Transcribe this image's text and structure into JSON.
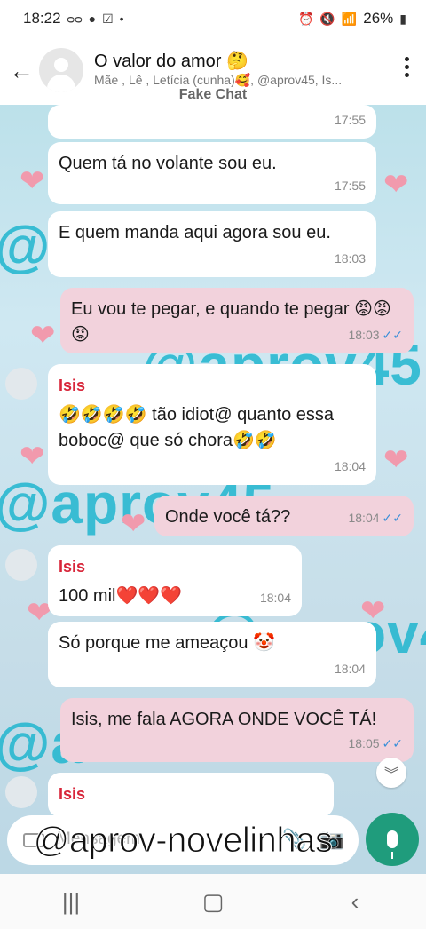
{
  "status": {
    "time": "18:22",
    "left_icons": [
      "voicemail-icon",
      "chat-icon",
      "check-icon",
      "dot-icon"
    ],
    "battery": "26%"
  },
  "header": {
    "title": "O valor do amor 🤔",
    "subtitle": "Mãe , Lê , Letícia (cunha)🥰, @aprov45, Is...",
    "fake_chat": "Fake Chat"
  },
  "watermarks": [
    "@a",
    "@aprov45",
    "@aprov45",
    "@aprov4",
    "@a"
  ],
  "messages": [
    {
      "dir": "in",
      "text": "",
      "time": "17:55"
    },
    {
      "dir": "in",
      "text": "Quem tá no volante sou eu.",
      "time": "17:55"
    },
    {
      "dir": "in",
      "text": "E quem manda aqui agora sou eu.",
      "time": "18:03"
    },
    {
      "dir": "out",
      "text": "Eu vou te pegar, e quando te pegar 😡😡😡",
      "time": "18:03",
      "ticks": "✓✓"
    },
    {
      "dir": "in",
      "sender": "Isis",
      "text": "🤣🤣🤣🤣 tão idiot@ quanto essa boboc@ que só chora🤣🤣",
      "time": "18:04"
    },
    {
      "dir": "out",
      "text": "Onde você tá??",
      "time": "18:04",
      "ticks": "✓✓"
    },
    {
      "dir": "in",
      "sender": "Isis",
      "text": "100 mil❤️❤️❤️",
      "time": "18:04"
    },
    {
      "dir": "in",
      "text": "Só porque me ameaçou 🤡",
      "time": "18:04"
    },
    {
      "dir": "out",
      "text": "Isis, me fala AGORA ONDE VOCÊ TÁ!",
      "time": "18:05",
      "ticks": "✓✓"
    },
    {
      "dir": "in",
      "sender": "Isis",
      "text": "",
      "time": ""
    }
  ],
  "input": {
    "placeholder": "Mensagem",
    "overlay": "@aprov-novelinhas"
  },
  "icons": {
    "back": "back-arrow-icon",
    "menu": "kebab-menu-icon",
    "scroll": "chevron-down-icon",
    "mic": "mic-icon"
  },
  "colors": {
    "incoming": "#ffffff",
    "outgoing": "#f2d2dc",
    "sender": "#d8263a",
    "mic": "#1f9c7c",
    "watermark": "#20b6cf"
  }
}
